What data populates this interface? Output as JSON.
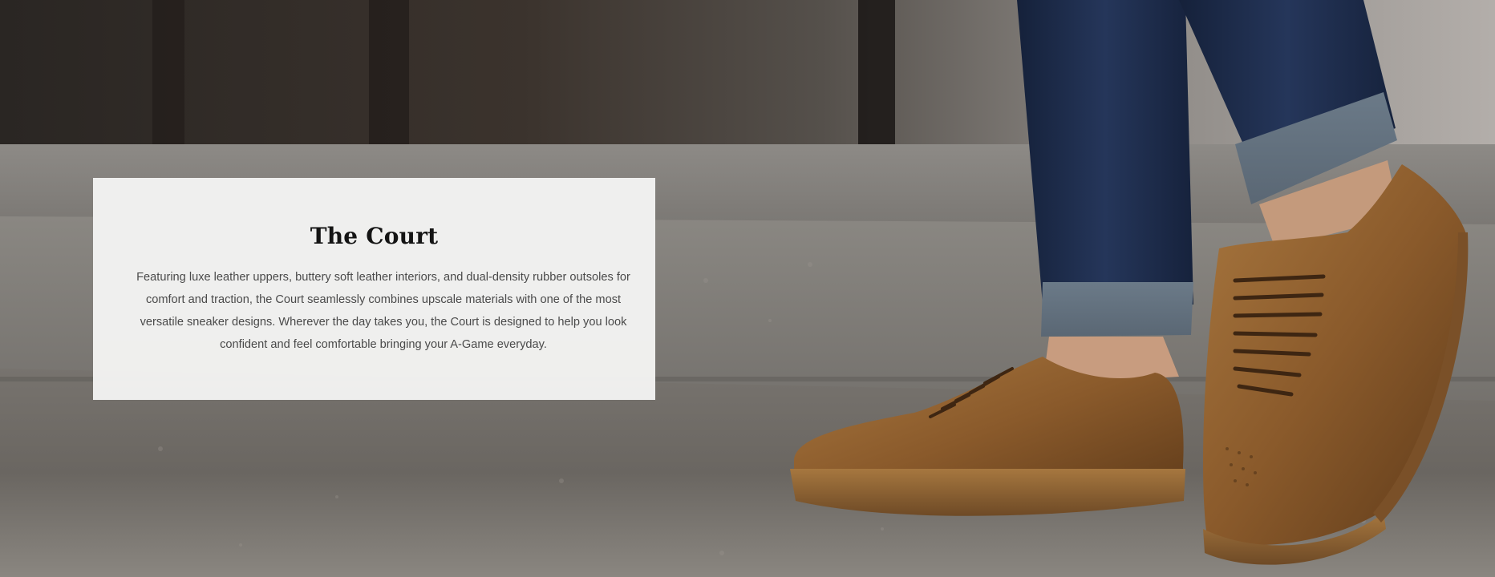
{
  "hero": {
    "image_alt": "Person in cuffed blue jeans wearing brown leather sneakers on stone steps",
    "colors": {
      "card_background": "#f4f4f3",
      "title": "#141414",
      "body_text": "#4a4a4a",
      "shoe_leather": "#8a5a2b",
      "denim": "#1c2a44"
    }
  },
  "card": {
    "title": "The Court",
    "description": "Featuring luxe leather uppers, buttery soft leather interiors, and dual-density rubber outsoles for comfort and traction, the Court seamlessly combines upscale materials with one of the most versatile sneaker designs. Wherever the day takes you, the Court is designed to help you look confident and feel comfortable bringing your A-Game everyday."
  }
}
